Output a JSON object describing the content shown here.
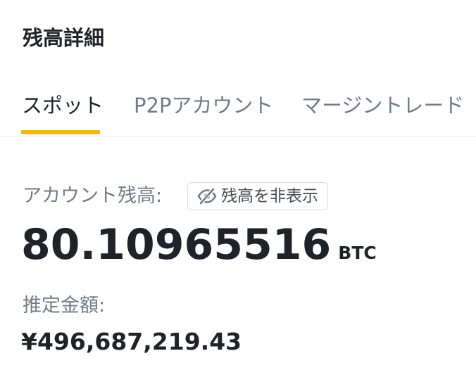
{
  "header": {
    "title": "残高詳細"
  },
  "tabs": [
    {
      "label": "スポット",
      "active": true
    },
    {
      "label": "P2Pアカウント",
      "active": false
    },
    {
      "label": "マージントレード",
      "active": false
    }
  ],
  "balance": {
    "label": "アカウント残高:",
    "hide_button_label": "残高を非表示",
    "hide_button_icon": "eye-slash-icon",
    "amount": "80.10965516",
    "unit": "BTC"
  },
  "estimate": {
    "label": "推定金額:",
    "value": "¥496,687,219.43"
  },
  "colors": {
    "accent": "#f0b90b",
    "text_primary": "#1e2329",
    "text_secondary": "#707a8a"
  }
}
